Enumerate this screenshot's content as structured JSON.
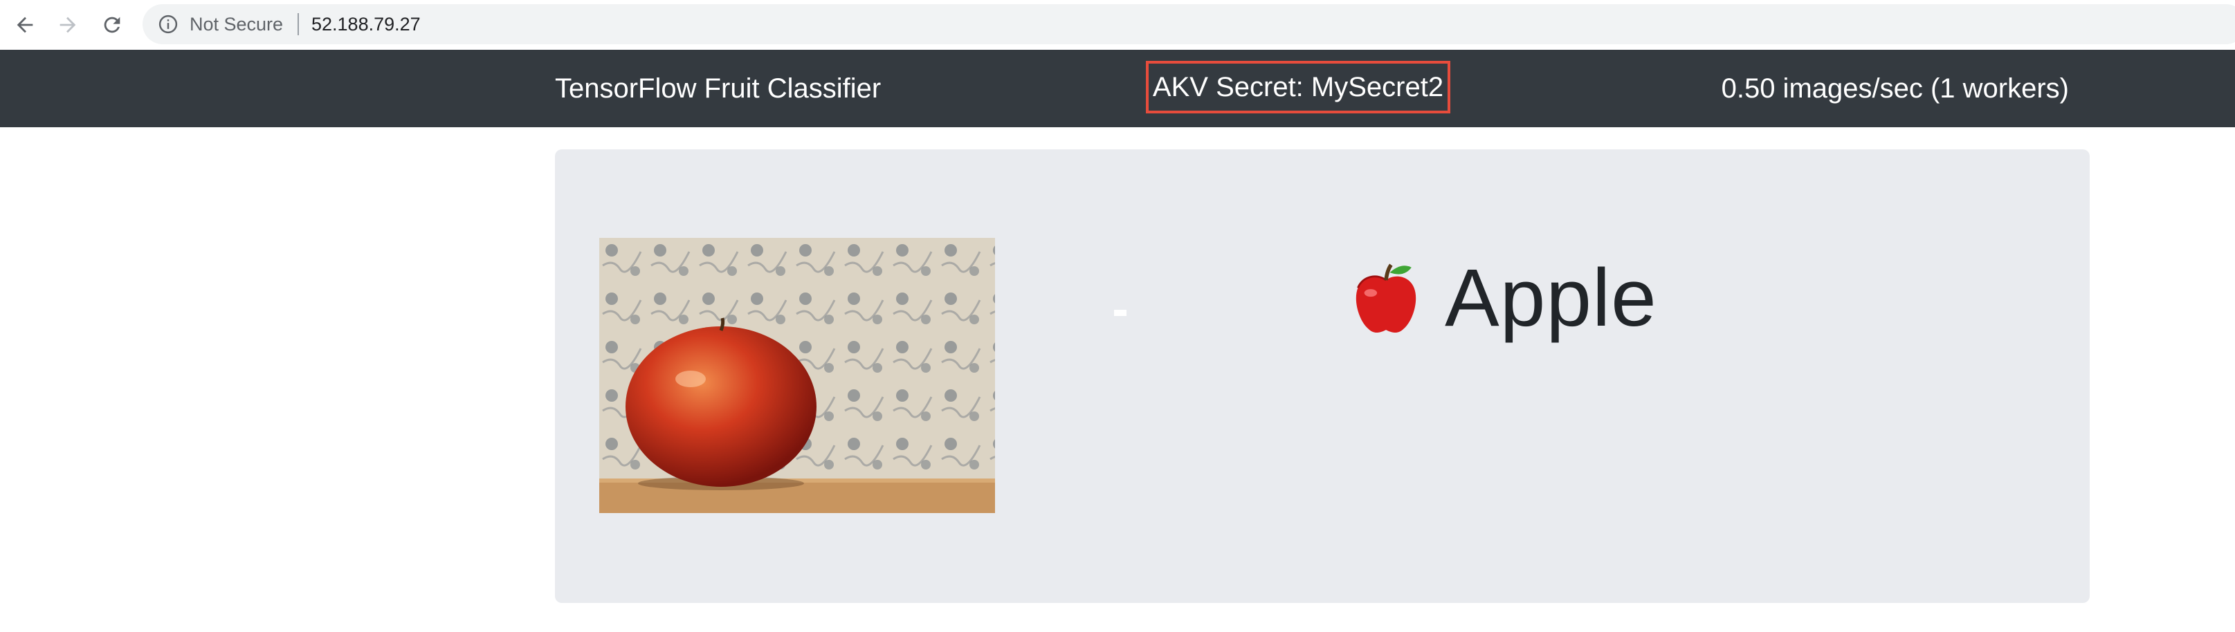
{
  "browser": {
    "security_label": "Not Secure",
    "url": "52.188.79.27"
  },
  "navbar": {
    "brand": "TensorFlow Fruit Classifier",
    "secret": "AKV Secret: MySecret2",
    "rate": "0.50 images/sec (1 workers)",
    "highlight_color": "#e74c3c"
  },
  "prediction": {
    "icon": "apple-icon",
    "label": "Apple"
  },
  "image": {
    "icon": "apple-photo"
  }
}
